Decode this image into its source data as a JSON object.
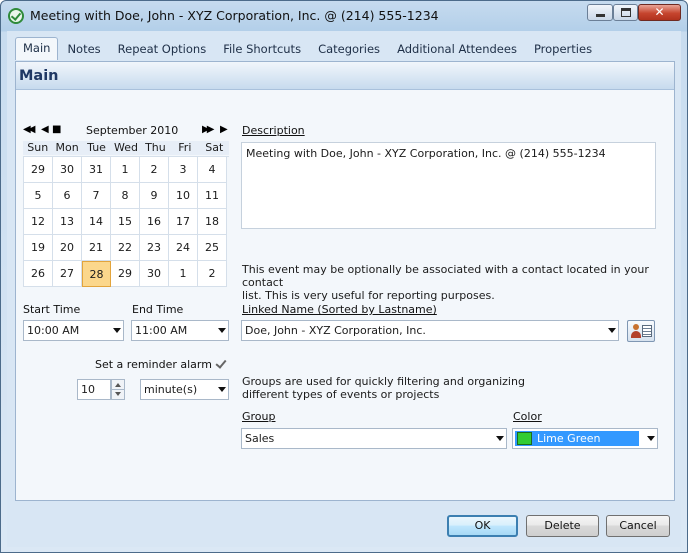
{
  "window": {
    "title": "Meeting with Doe, John - XYZ Corporation, Inc. @ (214) 555-1234"
  },
  "tabs": [
    {
      "label": "Main",
      "active": true
    },
    {
      "label": "Notes"
    },
    {
      "label": "Repeat Options"
    },
    {
      "label": "File Shortcuts"
    },
    {
      "label": "Categories"
    },
    {
      "label": "Additional Attendees"
    },
    {
      "label": "Properties"
    }
  ],
  "section_title": "Main",
  "calendar": {
    "month_label": "September 2010",
    "day_headers": [
      "Sun",
      "Mon",
      "Tue",
      "Wed",
      "Thu",
      "Fri",
      "Sat"
    ],
    "days": [
      "29",
      "30",
      "31",
      "1",
      "2",
      "3",
      "4",
      "5",
      "6",
      "7",
      "8",
      "9",
      "10",
      "11",
      "12",
      "13",
      "14",
      "15",
      "16",
      "17",
      "18",
      "19",
      "20",
      "21",
      "22",
      "23",
      "24",
      "25",
      "26",
      "27",
      "28",
      "29",
      "30",
      "1",
      "2"
    ],
    "selected_day": "28"
  },
  "description": {
    "label": "Description",
    "value": "Meeting with Doe, John - XYZ Corporation, Inc. @ (214) 555-1234"
  },
  "contact_info": {
    "line1": "This event may be optionally be associated with a contact located in your contact",
    "line2": "list.  This is very useful for reporting purposes."
  },
  "start_time": {
    "label": "Start Time",
    "value": "10:00 AM"
  },
  "end_time": {
    "label": "End Time",
    "value": "11:00 AM"
  },
  "linked_name": {
    "label": "Linked Name (Sorted by Lastname)",
    "value": "Doe, John - XYZ Corporation, Inc."
  },
  "reminder": {
    "label": "Set a reminder alarm",
    "checked": true,
    "amount": "10",
    "unit": "minute(s)"
  },
  "groups_info": {
    "line1": "Groups are used for quickly filtering and organizing",
    "line2": "different types of events or projects"
  },
  "group": {
    "label": "Group",
    "value": "Sales"
  },
  "color": {
    "label": "Color",
    "value": "Lime Green",
    "swatch": "#33cc33",
    "highlight": "#3399ff"
  },
  "buttons": {
    "ok": "OK",
    "delete": "Delete",
    "cancel": "Cancel"
  }
}
